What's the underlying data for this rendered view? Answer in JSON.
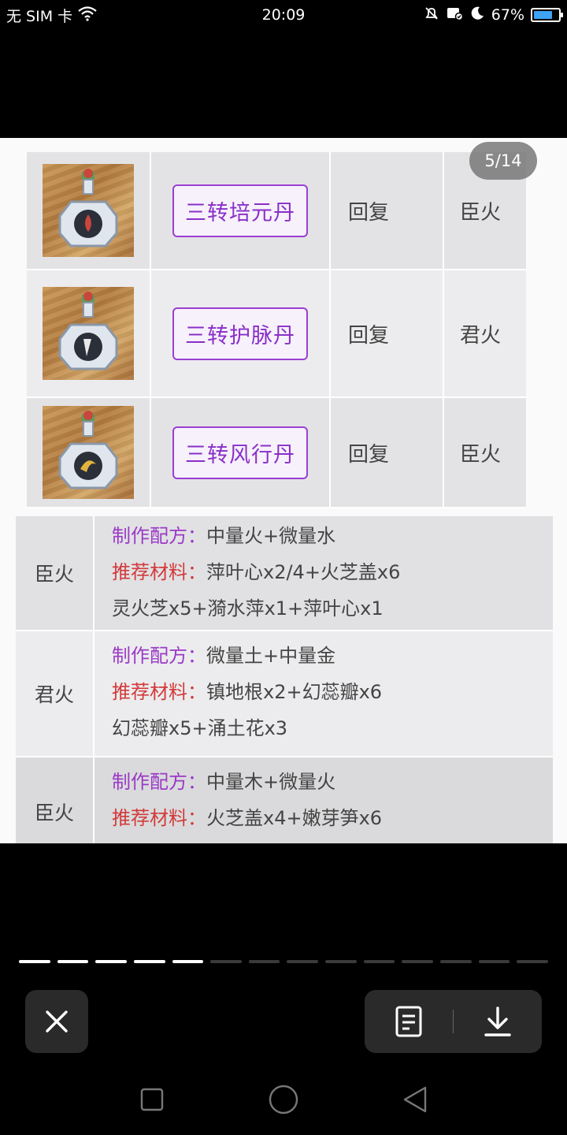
{
  "status_bar": {
    "carrier": "无 SIM 卡",
    "time": "20:09",
    "battery": "67%",
    "icons": [
      "wifi-icon",
      "alarm-off-icon",
      "notification-icon",
      "moon-icon",
      "battery-icon"
    ]
  },
  "viewer": {
    "page_indicator": "5/14",
    "potion_table": [
      {
        "name": "三转培元丹",
        "type": "回复",
        "fire": "臣火",
        "icon": "potion-bottle-icon"
      },
      {
        "name": "三转护脉丹",
        "type": "回复",
        "fire": "君火",
        "icon": "potion-bottle-icon"
      },
      {
        "name": "三转风行丹",
        "type": "回复",
        "fire": "臣火",
        "icon": "potion-bottle-icon"
      }
    ],
    "recipe_table": [
      {
        "fire": "臣火",
        "recipe_label": "制作配方：",
        "recipe": "中量火+微量水",
        "material_label": "推荐材料：",
        "materials": "萍叶心x2/4+火芝盖x6",
        "extra": "灵火芝x5+漪水萍x1+萍叶心x1"
      },
      {
        "fire": "君火",
        "recipe_label": "制作配方：",
        "recipe": "微量土+中量金",
        "material_label": "推荐材料：",
        "materials": "镇地根x2+幻蕊瓣x6",
        "extra": "幻蕊瓣x5+涌土花x3"
      },
      {
        "fire": "臣火",
        "recipe_label": "制作配方：",
        "recipe": "中量木+微量火",
        "material_label": "推荐材料：",
        "materials": "火芝盖x4+嫩芽笋x6",
        "extra": ""
      }
    ]
  },
  "progress": {
    "total": 14,
    "current": 5
  },
  "actions": {
    "close_icon": "close-icon",
    "details_icon": "document-icon",
    "download_icon": "download-icon"
  },
  "navbar": {
    "icons": [
      "recent-apps-icon",
      "home-icon",
      "back-icon"
    ]
  }
}
